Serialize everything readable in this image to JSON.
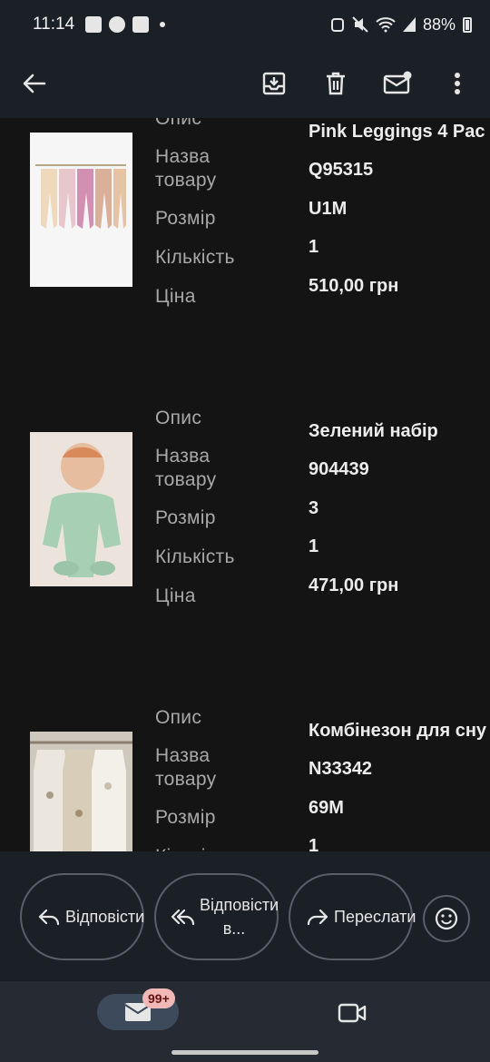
{
  "status_bar": {
    "time": "11:14",
    "battery": "88%"
  },
  "app_bar": {
    "back_icon": "arrow-left-icon",
    "actions": [
      "archive-icon",
      "delete-icon",
      "mark-unread-icon",
      "more-vert-icon"
    ]
  },
  "labels": {
    "description": "Опис",
    "product_name": "Назва товару",
    "size": "Розмір",
    "quantity": "Кількість",
    "price": "Ціна"
  },
  "products": [
    {
      "description": "Pink Leggings 4 Pac",
      "product_name": "Q95315",
      "size": "U1M",
      "quantity": "1",
      "price": "510,00 грн"
    },
    {
      "description": "Зелений набір",
      "product_name": "904439",
      "size": "3",
      "quantity": "1",
      "price": "471,00 грн"
    },
    {
      "description": "Комбінезон для сну",
      "product_name": "N33342",
      "size": "69M",
      "quantity": "1",
      "price": ""
    }
  ],
  "actions": {
    "reply": "Відповісти",
    "reply_all": "Відповісти в...",
    "forward": "Переслати"
  },
  "nav": {
    "mail_badge": "99+"
  },
  "colors": {
    "background": "#141414",
    "bar": "#1b1f26",
    "badge": "#f2b8b5"
  }
}
